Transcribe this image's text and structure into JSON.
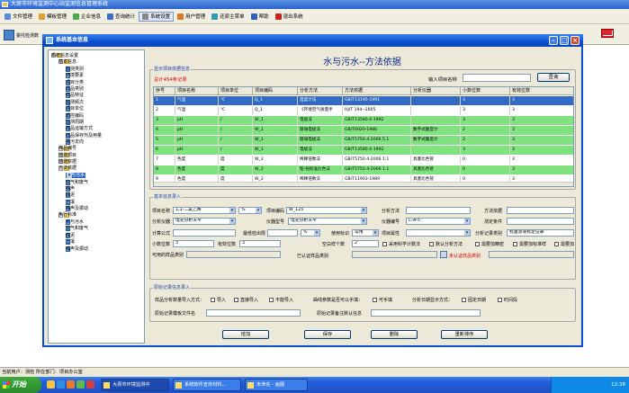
{
  "app": {
    "title": "大原市环境监测中心站监测信息管理系统",
    "menu": [
      {
        "label": "文件管理",
        "color": "#5a8ad8"
      },
      {
        "label": "模板管理",
        "color": "#e0a030"
      },
      {
        "label": "企业信息",
        "color": "#4caa4c"
      },
      {
        "label": "查询统计",
        "color": "#3d6ec8"
      },
      {
        "label": "系统设置",
        "color": "#888888"
      },
      {
        "label": "用户管理",
        "color": "#d87a2a"
      },
      {
        "label": "还原主菜单",
        "color": "#2aa0b0"
      },
      {
        "label": "帮助",
        "color": "#3060c0"
      },
      {
        "label": "退出系统",
        "color": "#d02020"
      }
    ],
    "toolbar_label": "委托检测数",
    "status": "当前用户：测检  所在部门：项目办公室"
  },
  "dialog": {
    "title": "系统基本信息",
    "heading": "水与污水--方法依据",
    "list_legend": "显示项目依据信息",
    "count_text": "总计454条记录",
    "search_label": "输入项目名称",
    "search_value": "",
    "search_button": "查询",
    "form_legend": "基本信息录入",
    "import_legend": "原始记录信息录入"
  },
  "tree": [
    {
      "label": "系统信息设置",
      "level": 0,
      "type": "folder",
      "box": "-"
    },
    {
      "label": "基本信息",
      "level": 1,
      "type": "folder",
      "box": "-"
    },
    {
      "label": "监测类别",
      "level": 2,
      "type": "page"
    },
    {
      "label": "环境要素",
      "level": 2,
      "type": "page"
    },
    {
      "label": "项目分类",
      "level": 2,
      "type": "page"
    },
    {
      "label": "样品类别",
      "level": 2,
      "type": "page"
    },
    {
      "label": "样品特征",
      "level": 2,
      "type": "page"
    },
    {
      "label": "监测频次",
      "level": 2,
      "type": "page"
    },
    {
      "label": "项目单位",
      "level": 2,
      "type": "page"
    },
    {
      "label": "质控编码",
      "level": 2,
      "type": "page"
    },
    {
      "label": "监测周期",
      "level": 2,
      "type": "page"
    },
    {
      "label": "样品运输方式",
      "level": 2,
      "type": "page"
    },
    {
      "label": "样品保存剂及用量",
      "level": 2,
      "type": "page"
    },
    {
      "label": "排污去向",
      "level": 2,
      "type": "page"
    },
    {
      "label": "样品编号",
      "level": 1,
      "type": "folder",
      "box": "+"
    },
    {
      "label": "监测项目",
      "level": 1,
      "type": "folder",
      "box": "+"
    },
    {
      "label": "监测依据",
      "level": 1,
      "type": "folder",
      "box": "+"
    },
    {
      "label": "方法依据",
      "level": 1,
      "type": "folder",
      "box": "-"
    },
    {
      "label": "水与污水",
      "level": 2,
      "type": "page",
      "selected": true
    },
    {
      "label": "空气和废气",
      "level": 2,
      "type": "page"
    },
    {
      "label": "噪声",
      "level": 2,
      "type": "page"
    },
    {
      "label": "底泥",
      "level": 2,
      "type": "page"
    },
    {
      "label": "土壤",
      "level": 2,
      "type": "page"
    },
    {
      "label": "噪声及振动",
      "level": 2,
      "type": "page"
    },
    {
      "label": "执行标准",
      "level": 1,
      "type": "folder",
      "box": "-"
    },
    {
      "label": "水与污水",
      "level": 2,
      "type": "page"
    },
    {
      "label": "空气和废气",
      "level": 2,
      "type": "page"
    },
    {
      "label": "底泥",
      "level": 2,
      "type": "page"
    },
    {
      "label": "土壤",
      "level": 2,
      "type": "page"
    },
    {
      "label": "噪声及振动",
      "level": 2,
      "type": "page"
    }
  ],
  "grid": {
    "columns": [
      "序号",
      "项目名称",
      "项目单位",
      "项目编码",
      "分析方法",
      "方法依据",
      "分析仪器",
      "小数位数",
      "有效位数"
    ],
    "rows": [
      {
        "c": [
          "1",
          "气温",
          "℃",
          "Q_1",
          "温度计法",
          "GB/T13195-1991",
          "",
          "3",
          "3"
        ],
        "style": "selected"
      },
      {
        "c": [
          "2",
          "气温",
          "℃",
          "Q_1",
          "《环境空气质量手",
          "HJ/T 194--2005",
          "",
          "3",
          "3"
        ],
        "style": "white"
      },
      {
        "c": [
          "3",
          "pH",
          "/",
          "W_1",
          "电极法",
          "GB/T13580.4-1992",
          "",
          "3",
          "3"
        ],
        "style": "green"
      },
      {
        "c": [
          "4",
          "pH",
          "/",
          "W_1",
          "玻璃电极法",
          "GB/T6920-1986",
          "数字式酸度计",
          "2",
          "3"
        ],
        "style": "green"
      },
      {
        "c": [
          "5",
          "pH",
          "/",
          "W_1",
          "玻璃电极法",
          "GB/T5750.4-2006 5.1",
          "数字式酸度计",
          "2",
          "3"
        ],
        "style": "green"
      },
      {
        "c": [
          "6",
          "pH",
          "/",
          "W_1",
          "电极法",
          "GB/T13580.4-1992",
          "",
          "3",
          "3"
        ],
        "style": "green"
      },
      {
        "c": [
          "7",
          "色度",
          "度",
          "W_2",
          "稀释倍数法",
          "GB/T5750.4-2006 1.1",
          "具塞比色管",
          "0",
          "3"
        ],
        "style": "white"
      },
      {
        "c": [
          "8",
          "色度",
          "度",
          "W_2",
          "铂-钴标准比色法",
          "GB/T5750.4-2006 1.1",
          "具塞比色管",
          "0",
          "3"
        ],
        "style": "green"
      },
      {
        "c": [
          "9",
          "色度",
          "度",
          "W_2",
          "稀释倍数法",
          "GB/T11903-1989",
          "具塞比色管",
          "0",
          "3"
        ],
        "style": "white"
      }
    ]
  },
  "form": {
    "project_name_label": "项目名称",
    "project_name": "1,1-二氯乙烯",
    "unit_value": "%",
    "project_code_label": "项目编码",
    "project_code": "W_125",
    "analysis_method_label": "分析方法",
    "analysis_method": "",
    "method_basis_label": "方法依据",
    "method_basis": "",
    "instrument_label": "分析仪器",
    "instrument": "电光分析天平",
    "instrument_model_label": "仪器型号",
    "instrument_model": "电光分析天平",
    "instrument_no_label": "仪器编号",
    "instrument_no": "C-A-5",
    "conditions_label": "测定条件",
    "conditions": "",
    "formula_label": "计算公式",
    "formula": "",
    "min_limit_label": "最低检出限",
    "min_limit": "",
    "min_limit_unit": "%",
    "use_flag_label": "使用标识",
    "use_flag": "常用",
    "project_attr_label": "项目属性",
    "project_attr": "",
    "record_type_label": "分析记录类别",
    "record_type": "标准溶液标定记录",
    "decimal_label": "小数位数",
    "decimal": "3",
    "sigfig_label": "有效位数",
    "sigfig": "3",
    "blank_label": "空白样个数",
    "blank": "2",
    "chk_calc": "采用科学计数法",
    "chk_default": "默认分析方法",
    "chk_prec": "需要加精密",
    "chk_std": "需要加标准样",
    "chk_more": "需要加",
    "usable_label": "可用的样品类别",
    "usable": "",
    "recorded_label": "已认证样品类别",
    "recorded": "",
    "uncert_label": "未认证样品类别",
    "uncert": ""
  },
  "import": {
    "mode_label": "样品分析数量导入方式：",
    "opt_import": "导入",
    "opt_direct": "直接导入",
    "opt_none": "不能导入",
    "opt_param_label": "曲线参数是否可以手填：",
    "opt_param": "可手填",
    "time_label": "分析日期显示方式：",
    "opt_fixed": "固定日期",
    "opt_period": "时间段",
    "tpl_label": "原始记录模板文件名",
    "tpl": "",
    "note_label": "原始记录备注默认信息",
    "note": ""
  },
  "buttons": {
    "add": "增加",
    "save": "保存",
    "delete": "删除",
    "resort": "重新排序"
  },
  "taskbar": {
    "start": "开始",
    "tasks": [
      "大原市环境监测中",
      "系统软件宣传材料...",
      "未命名 - 画图"
    ],
    "clock": "12:38"
  }
}
